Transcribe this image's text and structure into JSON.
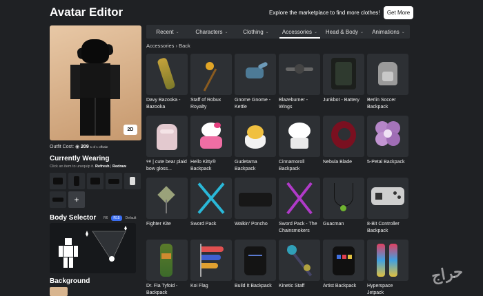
{
  "header": {
    "title": "Avatar Editor",
    "promo_text": "Explore the marketplace to find more clothes!",
    "get_more_label": "Get More"
  },
  "avatar": {
    "toggle_label": "2D",
    "outfit_cost_label": "Outfit Cost:",
    "outfit_cost_value": "209",
    "outfit_cost_suffix": "1 of 1 offsale"
  },
  "currently_wearing": {
    "title": "Currently Wearing",
    "hint": "Click an item to unequip it.",
    "refresh_label": "Refresh",
    "redraw_label": "Redraw",
    "add_label": "+"
  },
  "body_selector": {
    "title": "Body Selector",
    "options": [
      "R6",
      "R15",
      "Default"
    ],
    "selected": "R15"
  },
  "background": {
    "title": "Background"
  },
  "tabs": [
    {
      "label": "Recent"
    },
    {
      "label": "Characters"
    },
    {
      "label": "Clothing"
    },
    {
      "label": "Accessories"
    },
    {
      "label": "Head & Body"
    },
    {
      "label": "Animations"
    }
  ],
  "active_tab": "Accessories",
  "breadcrumb": "Accessories › Back",
  "items": [
    {
      "name": "Davy Bazooka - Bazooka",
      "icon": "bazooka-icon"
    },
    {
      "name": "Staff of Robux Royalty",
      "icon": "staff-icon"
    },
    {
      "name": "Gnome Gnome - Kettle",
      "icon": "kettle-icon"
    },
    {
      "name": "Blazeburner - Wings",
      "icon": "wings-icon"
    },
    {
      "name": "Junkbot - Battery",
      "icon": "battery-icon"
    },
    {
      "name": "Berlin Soccer Backpack",
      "icon": "backpack-icon"
    },
    {
      "name": "୨୧ | cute bear plaid bow gloss...",
      "icon": "bear-bag-icon"
    },
    {
      "name": "Hello Kitty® Backpack",
      "icon": "hello-kitty-icon"
    },
    {
      "name": "Gudetama Backpack",
      "icon": "egg-icon"
    },
    {
      "name": "Cinnamoroll Backpack",
      "icon": "cinnamoroll-icon"
    },
    {
      "name": "Nebula Blade",
      "icon": "blade-icon"
    },
    {
      "name": "5-Petal Backpack",
      "icon": "flower-icon"
    },
    {
      "name": "Fighter Kite",
      "icon": "kite-icon"
    },
    {
      "name": "Sword Pack",
      "icon": "swords-icon"
    },
    {
      "name": "Walkin' Poncho",
      "icon": "poncho-icon"
    },
    {
      "name": "Sword Pack - The Chainsmokers",
      "icon": "purple-swords-icon"
    },
    {
      "name": "Guacman",
      "icon": "necklace-icon"
    },
    {
      "name": "8-Bit Controller Backpack",
      "icon": "controller-icon"
    },
    {
      "name": "Dr. Fia Tyfoid - Backpack",
      "icon": "lantern-icon"
    },
    {
      "name": "Koi Flag",
      "icon": "koi-flag-icon"
    },
    {
      "name": "Build It Backpack",
      "icon": "dark-backpack-icon"
    },
    {
      "name": "Kinetic Staff",
      "icon": "kinetic-staff-icon"
    },
    {
      "name": "Artist Backpack",
      "icon": "artist-backpack-icon"
    },
    {
      "name": "Hyperspace Jetpack",
      "icon": "jetpack-icon"
    }
  ],
  "watermark": "حراج",
  "colors": {
    "background": "#1f2124",
    "panel": "#2d3034",
    "accent": "#3a6df0"
  }
}
